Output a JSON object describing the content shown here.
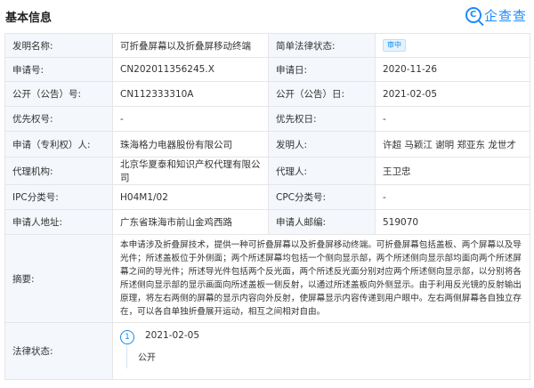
{
  "header": {
    "title": "基本信息",
    "brand": "企查查",
    "brand_icon": "qcc-search-logo-icon"
  },
  "rows": {
    "invention_name": {
      "label": "发明名称:",
      "value": "可折叠屏幕以及折叠屏移动终端"
    },
    "legal_status_simple": {
      "label": "简单法律状态:",
      "value": "审中"
    },
    "app_no": {
      "label": "申请号:",
      "value": "CN202011356245.X"
    },
    "app_date": {
      "label": "申请日:",
      "value": "2020-11-26"
    },
    "pub_no": {
      "label": "公开（公告）号:",
      "value": "CN112333310A"
    },
    "pub_date": {
      "label": "公开（公告）日:",
      "value": "2021-02-05"
    },
    "priority_no": {
      "label": "优先权号:",
      "value": "-"
    },
    "priority_date": {
      "label": "优先权日:",
      "value": "-"
    },
    "applicant": {
      "label": "申请（专利权）人:",
      "value": "珠海格力电器股份有限公司"
    },
    "inventor": {
      "label": "发明人:",
      "value": "许超 马颖江 谢明 郑亚东 龙世才"
    },
    "agency": {
      "label": "代理机构:",
      "value": "北京华夏泰和知识产权代理有限公司"
    },
    "agent": {
      "label": "代理人:",
      "value": "王卫忠"
    },
    "ipc": {
      "label": "IPC分类号:",
      "value": "H04M1/02"
    },
    "cpc": {
      "label": "CPC分类号:",
      "value": "-"
    },
    "address": {
      "label": "申请人地址:",
      "value": "广东省珠海市前山金鸡西路"
    },
    "postcode": {
      "label": "申请人邮编:",
      "value": "519070"
    },
    "abstract": {
      "label": "摘要:",
      "value": "本申请涉及折叠屏技术，提供一种可折叠屏幕以及折叠屏移动终端。可折叠屏幕包括盖板、两个屏幕以及导光件；所述盖板位于外侧面；两个所述屏幕均包括一个侧向显示部，两个所述侧向显示部均面向两个所述屏幕之间的导光件；所述导光件包括两个反光面，两个所述反光面分别对应两个所述侧向显示部，以分别将各所述侧向显示部的显示画面向所述盖板一侧反射，以通过所述盖板向外侧显示。由于利用反光镜的反射输出原理，将左右两侧的屏幕的显示内容向外反射，使屏幕显示内容传递到用户眼中。左右两侧屏幕各自独立存在，可以各自单独折叠展开运动，相互之间相对自由。"
    },
    "legal_status": {
      "label": "法律状态:",
      "index": "1",
      "date": "2021-02-05",
      "status": "公开"
    }
  }
}
